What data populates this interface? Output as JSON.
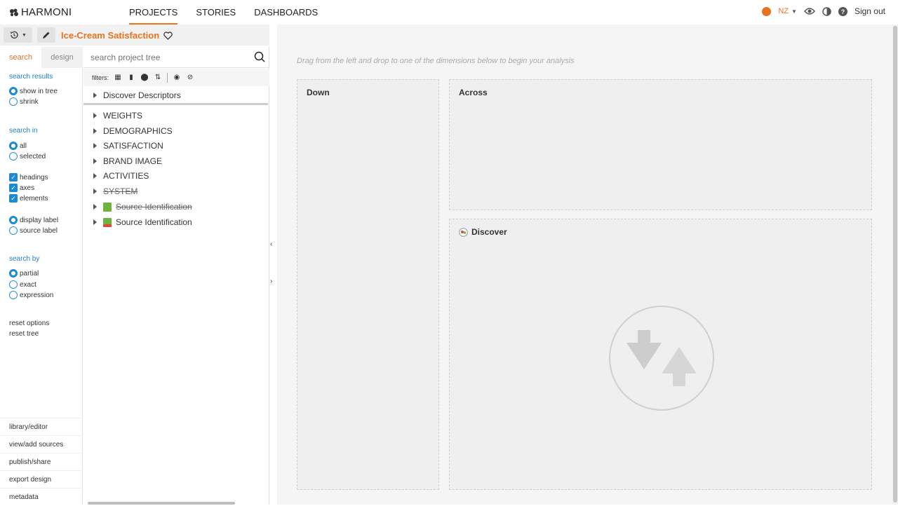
{
  "app": {
    "logo_text": "HARMONI",
    "nav_tabs": [
      {
        "label": "PROJECTS",
        "active": true
      },
      {
        "label": "STORIES",
        "active": false
      },
      {
        "label": "DASHBOARDS",
        "active": false
      }
    ],
    "language": "NZ",
    "sign_out_label": "Sign out",
    "accent_color": "#e8731f",
    "link_color": "#1f7fc4"
  },
  "project": {
    "title": "Ice-Cream Satisfaction"
  },
  "left_options": {
    "tabs": [
      {
        "label": "search",
        "active": true
      },
      {
        "label": "design",
        "active": false
      }
    ],
    "search_results_heading": "search results",
    "search_results_options": [
      {
        "label": "show in tree",
        "selected": true
      },
      {
        "label": "shrink",
        "selected": false
      }
    ],
    "search_in_heading": "search in",
    "search_in_options": [
      {
        "label": "all",
        "selected": true
      },
      {
        "label": "selected",
        "selected": false
      }
    ],
    "search_in_checks": [
      {
        "label": "headings",
        "checked": true
      },
      {
        "label": "axes",
        "checked": true
      },
      {
        "label": "elements",
        "checked": true
      }
    ],
    "label_options": [
      {
        "label": "display label",
        "selected": true
      },
      {
        "label": "source label",
        "selected": false
      }
    ],
    "search_by_heading": "search by",
    "search_by_options": [
      {
        "label": "partial",
        "selected": true
      },
      {
        "label": "exact",
        "selected": false
      },
      {
        "label": "expression",
        "selected": false
      }
    ],
    "reset_options_label": "reset options",
    "reset_tree_label": "reset tree",
    "bottom_links": [
      "library/editor",
      "view/add sources",
      "publish/share",
      "export design",
      "metadata"
    ]
  },
  "tree": {
    "search_placeholder": "search project tree",
    "filters_label": "filters:",
    "descriptors_label": "Discover Descriptors",
    "items": [
      {
        "label": "WEIGHTS",
        "strike": false
      },
      {
        "label": "DEMOGRAPHICS",
        "strike": false
      },
      {
        "label": "SATISFACTION",
        "strike": false
      },
      {
        "label": "BRAND IMAGE",
        "strike": false
      },
      {
        "label": "ACTIVITIES",
        "strike": false
      },
      {
        "label": "SYSTEM",
        "strike": true
      },
      {
        "label": "Source Identification",
        "strike": true,
        "icon": "source-green-icon"
      },
      {
        "label": "Source Identification",
        "strike": false,
        "icon": "source-red-icon"
      }
    ]
  },
  "main": {
    "hint": "Drag from the left and drop to one of the dimensions below to begin your analysis",
    "down_label": "Down",
    "across_label": "Across",
    "discover_label": "Discover"
  }
}
